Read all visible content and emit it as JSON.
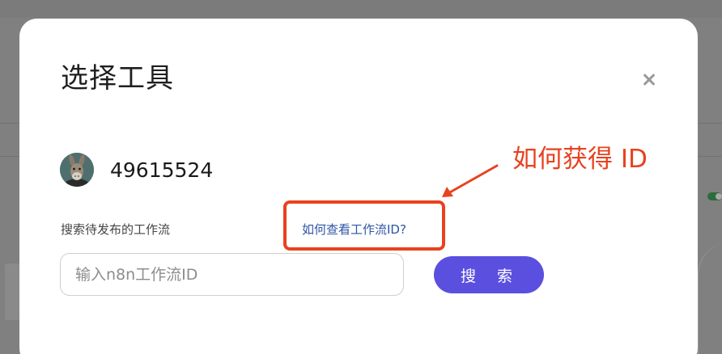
{
  "modal": {
    "title": "选择工具",
    "user": {
      "id_text": "49615524"
    },
    "search": {
      "label": "搜索待发布的工作流",
      "help_link": "如何查看工作流ID?",
      "input_placeholder": "输入n8n工作流ID",
      "input_value": "",
      "button_label": "搜 索"
    }
  },
  "annotation": {
    "text": "如何获得 ID",
    "color": "#e8421f"
  },
  "colors": {
    "primary_button": "#5b4fe0",
    "link": "#2e55a5",
    "overlay": "#808080"
  },
  "icons": {
    "close": "close-icon",
    "avatar": "donkey-avatar"
  }
}
